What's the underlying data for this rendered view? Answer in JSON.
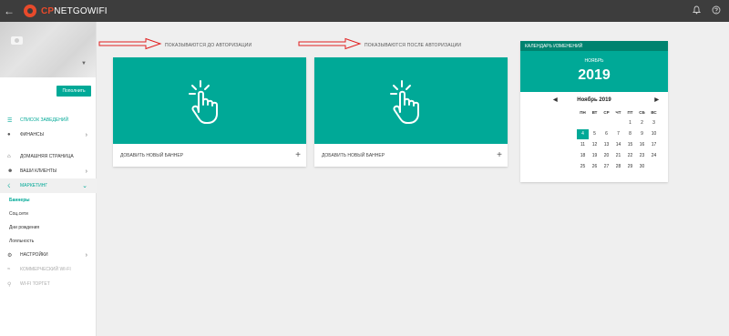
{
  "topbar": {
    "logo_cp": "CP",
    "logo_rest": "NETGOWIFI"
  },
  "sidebar": {
    "topup_label": "Пополнить",
    "items": [
      {
        "label": "СПИСОК ЗАВЕДЕНИЙ"
      },
      {
        "label": "ФИНАНСЫ"
      },
      {
        "label": "ДОМАШНЯЯ СТРАНИЦА"
      },
      {
        "label": "ВАШИ КЛИЕНТЫ"
      },
      {
        "label": "МАРКЕТИНГ"
      },
      {
        "label": "НАСТРОЙКИ"
      },
      {
        "label": "КОММЕРЧЕСКИЙ WI-FI"
      },
      {
        "label": "WI-FI ТОРГЕТ"
      }
    ],
    "marketing_sub": [
      {
        "label": "Баннеры"
      },
      {
        "label": "Соц.сети"
      },
      {
        "label": "Дни рождения"
      },
      {
        "label": "Лояльность"
      }
    ]
  },
  "main": {
    "label_before": "ПОКАЗЫВАЮТСЯ ДО АВТОРИЗАЦИИ",
    "label_after": "ПОКАЗЫВАЮТСЯ ПОСЛЕ АВТОРИЗАЦИИ",
    "add_banner_1": "ДОБАВИТЬ НОВЫЙ БАННЕР",
    "add_banner_2": "ДОБАВИТЬ НОВЫЙ БАННЕР",
    "plus": "+",
    "accent_color": "#00a997",
    "arrow_color": "#e02020"
  },
  "calendar": {
    "header": "КАЛЕНДАРЬ ИЗМЕНЕНИЙ",
    "month_small": "НОЯБРЬ",
    "year": "2019",
    "month_nav": "Ноябрь 2019",
    "weekdays": [
      "ПН",
      "ВТ",
      "СР",
      "ЧТ",
      "ПТ",
      "СБ",
      "ВС"
    ],
    "weeks": [
      [
        "",
        "",
        "",
        "",
        "1",
        "2",
        "3"
      ],
      [
        "4",
        "5",
        "6",
        "7",
        "8",
        "9",
        "10"
      ],
      [
        "11",
        "12",
        "13",
        "14",
        "15",
        "16",
        "17"
      ],
      [
        "18",
        "19",
        "20",
        "21",
        "22",
        "23",
        "24"
      ],
      [
        "25",
        "26",
        "27",
        "28",
        "29",
        "30",
        ""
      ]
    ],
    "selected": "4"
  }
}
